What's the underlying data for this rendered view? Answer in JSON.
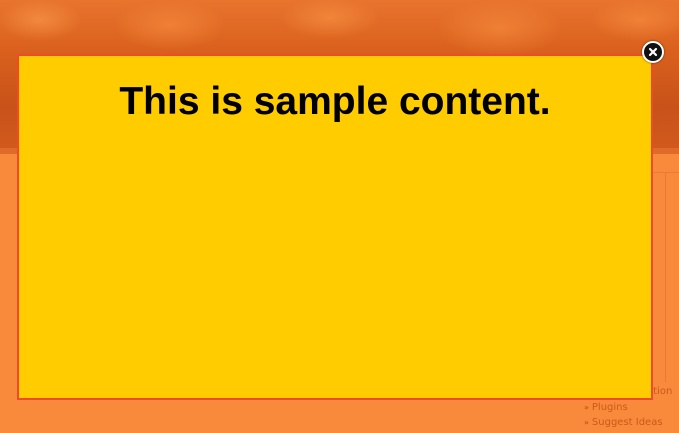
{
  "modal": {
    "content_text": "This is sample content.",
    "close_icon": "close-icon",
    "background_color": "#ffcc00",
    "border_color": "#f04a2e"
  },
  "page": {
    "background_color": "#f98a3c",
    "banner_color": "#d9601c",
    "side_links": [
      {
        "label": "Plugins"
      },
      {
        "label": "Suggest Ideas"
      }
    ],
    "side_link_fragment": "ation",
    "side_link_mark": "/"
  }
}
